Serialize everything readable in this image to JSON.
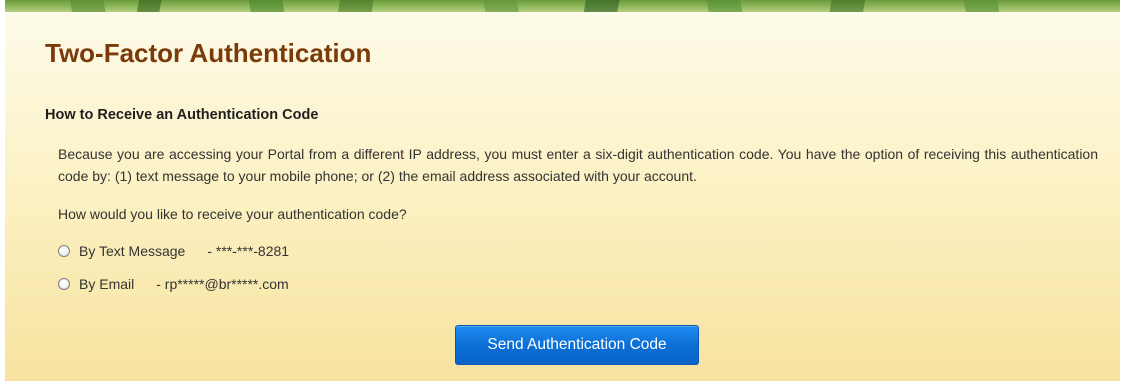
{
  "page": {
    "title": "Two-Factor Authentication"
  },
  "section": {
    "heading": "How to Receive an Authentication Code",
    "description": "Because you are accessing your Portal from a different IP address, you must enter a six-digit authentication code. You have the option of receiving this authentication code by: (1) text message to your mobile phone; or (2) the email address associated with your account.",
    "prompt": "How would you like to receive your authentication code?"
  },
  "options": [
    {
      "label": "By Text Message",
      "value": "- ***-***-8281",
      "selected": false
    },
    {
      "label": "By Email",
      "value": "- rp*****@br*****.com",
      "selected": false
    }
  ],
  "actions": {
    "send_label": "Send Authentication Code"
  },
  "colors": {
    "title": "#7a3a0a",
    "panel_top": "#fdfbe9",
    "panel_bottom": "#f7e39f",
    "button": "#0b6fd6"
  }
}
